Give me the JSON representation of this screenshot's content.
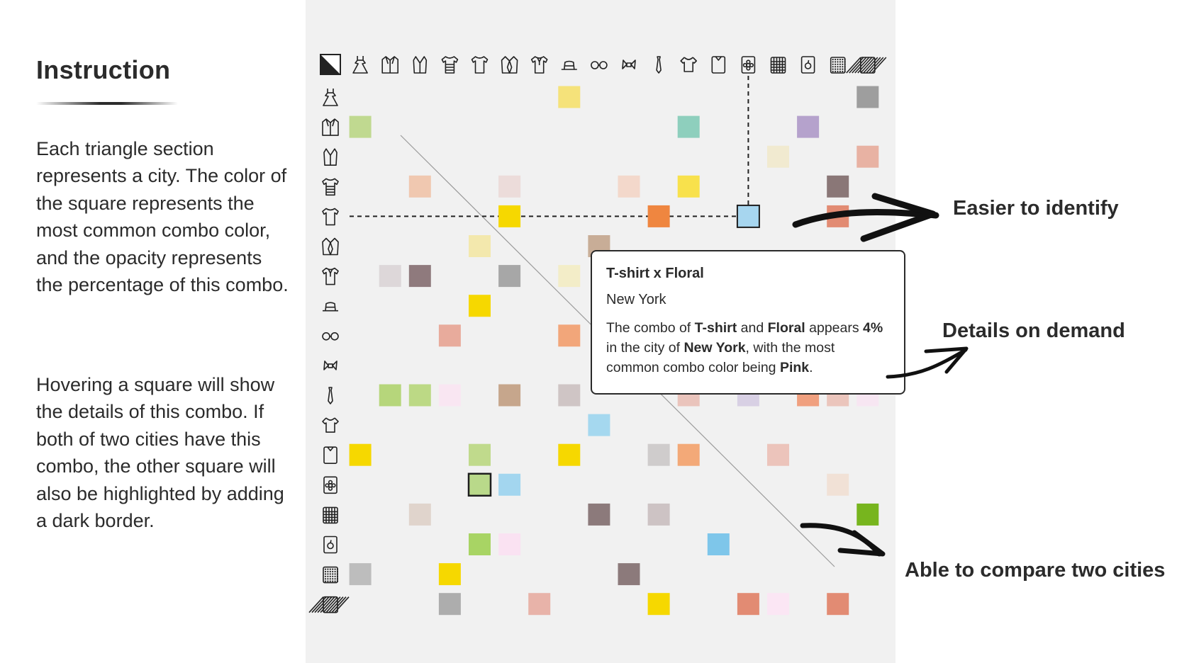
{
  "instruction": {
    "title": "Instruction",
    "paragraph1": "Each triangle section represents a city. The color of the square represents the most common combo color, and the opacity represents the percentage of this combo.",
    "paragraph2": "Hovering a square will show the details of this combo. If both of two cities have this combo, the other square will also be highlighted by adding a dark border."
  },
  "matrix": {
    "corner_icon": "half-triangle-icon",
    "items": [
      "dress",
      "jacket",
      "vest",
      "sweater",
      "t-shirt",
      "blazer",
      "polo",
      "hat",
      "glasses",
      "bow-tie",
      "tie",
      "blouse",
      "shirt",
      "floral",
      "plaid",
      "fruit-print",
      "polka-dot",
      "striped"
    ],
    "cells": [
      [
        0,
        8,
        "#f5e27a"
      ],
      [
        0,
        18,
        "#9e9e9e"
      ],
      [
        1,
        1,
        "#c0d990"
      ],
      [
        1,
        12,
        "#8ecfbd"
      ],
      [
        1,
        16,
        "#b5a2cc"
      ],
      [
        2,
        15,
        "#f1ead0"
      ],
      [
        2,
        18,
        "#e8b2a3"
      ],
      [
        3,
        3,
        "#f0c8b0"
      ],
      [
        3,
        6,
        "#ecdcda"
      ],
      [
        3,
        10,
        "#f3d8cb"
      ],
      [
        3,
        12,
        "#f8e14c"
      ],
      [
        3,
        17,
        "#8a7777"
      ],
      [
        4,
        6,
        "#f6d800"
      ],
      [
        4,
        11,
        "#ef8640"
      ],
      [
        4,
        14,
        "#a7d6ef"
      ],
      [
        4,
        17,
        "#e28b73"
      ],
      [
        5,
        5,
        "#f3e8ad"
      ],
      [
        5,
        9,
        "#c8ad97"
      ],
      [
        6,
        2,
        "#ddd7d9"
      ],
      [
        6,
        3,
        "#8f7a7d"
      ],
      [
        6,
        6,
        "#a7a7a7"
      ],
      [
        6,
        8,
        "#f3edc8"
      ],
      [
        7,
        5,
        "#f6d800"
      ],
      [
        8,
        4,
        "#e8ab9c"
      ],
      [
        8,
        8,
        "#f2a67a"
      ],
      [
        10,
        2,
        "#b6d67b"
      ],
      [
        10,
        3,
        "#bcd985"
      ],
      [
        10,
        4,
        "#f9e6f2"
      ],
      [
        10,
        6,
        "#c6a68c"
      ],
      [
        10,
        8,
        "#cfc5c5"
      ],
      [
        10,
        12,
        "#eac4bc"
      ],
      [
        10,
        14,
        "#d8d0e4"
      ],
      [
        10,
        16,
        "#f0a07f"
      ],
      [
        10,
        17,
        "#ebc5bc"
      ],
      [
        10,
        18,
        "#f7e6f2"
      ],
      [
        11,
        9,
        "#a5d8ef"
      ],
      [
        12,
        1,
        "#f6d800"
      ],
      [
        12,
        5,
        "#c0da8c"
      ],
      [
        12,
        8,
        "#f6d800"
      ],
      [
        12,
        11,
        "#cfcccc"
      ],
      [
        12,
        12,
        "#f3a978"
      ],
      [
        12,
        15,
        "#ecc4bb"
      ],
      [
        13,
        5,
        "#b9d98a"
      ],
      [
        13,
        6,
        "#a3d6ef"
      ],
      [
        13,
        17,
        "#f1e1d6"
      ],
      [
        14,
        3,
        "#e0d4cc"
      ],
      [
        14,
        9,
        "#8c7a7b"
      ],
      [
        14,
        11,
        "#cdc3c4"
      ],
      [
        14,
        18,
        "#77b51e"
      ],
      [
        15,
        5,
        "#a8d464"
      ],
      [
        15,
        6,
        "#fae2f2"
      ],
      [
        15,
        13,
        "#7ec6ea"
      ],
      [
        16,
        1,
        "#bdbdbd"
      ],
      [
        16,
        4,
        "#f6d800"
      ],
      [
        16,
        10,
        "#8c7a7b"
      ],
      [
        17,
        4,
        "#adadad"
      ],
      [
        17,
        7,
        "#e8b3a9"
      ],
      [
        17,
        11,
        "#f6d800"
      ],
      [
        17,
        14,
        "#e28b73"
      ],
      [
        17,
        15,
        "#fbe6f4"
      ],
      [
        17,
        17,
        "#e28b73"
      ]
    ],
    "highlight_cell": [
      4,
      14
    ],
    "compare_cell": [
      13,
      5
    ]
  },
  "tooltip": {
    "title": "T-shirt x Floral",
    "city": "New York",
    "text_1": "The combo of ",
    "item_a": "T-shirt",
    "text_2": " and ",
    "item_b": "Floral",
    "text_3": " appears ",
    "percent": "4%",
    "text_4": " in the city of ",
    "city_bold": "New York",
    "text_5": ", with the most common combo color being ",
    "color_name": "Pink",
    "text_6": "."
  },
  "callouts": {
    "identify": "Easier to identify",
    "details": "Details on demand",
    "compare": "Able to compare two cities"
  }
}
